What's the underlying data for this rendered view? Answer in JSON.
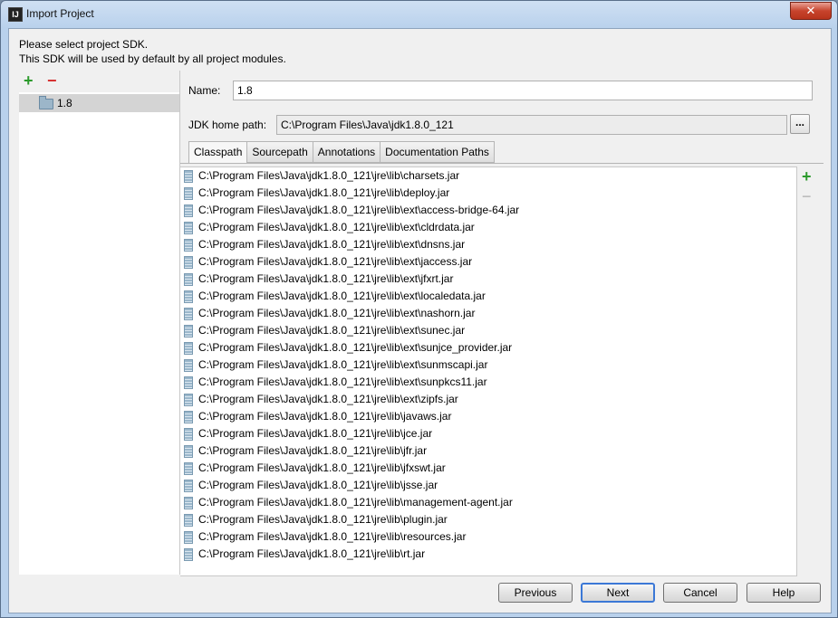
{
  "window": {
    "title": "Import Project",
    "app_icon": "IJ",
    "close_glyph": "✕"
  },
  "message": {
    "line1": "Please select project SDK.",
    "line2": "This SDK will be used by default by all project modules."
  },
  "sdk_list": {
    "add_glyph": "+",
    "remove_glyph": "−",
    "items": [
      "1.8"
    ]
  },
  "form": {
    "name_label": "Name:",
    "name_value": "1.8",
    "jdk_label": "JDK home path:",
    "jdk_value": "C:\\Program Files\\Java\\jdk1.8.0_121",
    "browse_label": "..."
  },
  "tabs": [
    "Classpath",
    "Sourcepath",
    "Annotations",
    "Documentation Paths"
  ],
  "active_tab": "Classpath",
  "classpath": [
    "C:\\Program Files\\Java\\jdk1.8.0_121\\jre\\lib\\charsets.jar",
    "C:\\Program Files\\Java\\jdk1.8.0_121\\jre\\lib\\deploy.jar",
    "C:\\Program Files\\Java\\jdk1.8.0_121\\jre\\lib\\ext\\access-bridge-64.jar",
    "C:\\Program Files\\Java\\jdk1.8.0_121\\jre\\lib\\ext\\cldrdata.jar",
    "C:\\Program Files\\Java\\jdk1.8.0_121\\jre\\lib\\ext\\dnsns.jar",
    "C:\\Program Files\\Java\\jdk1.8.0_121\\jre\\lib\\ext\\jaccess.jar",
    "C:\\Program Files\\Java\\jdk1.8.0_121\\jre\\lib\\ext\\jfxrt.jar",
    "C:\\Program Files\\Java\\jdk1.8.0_121\\jre\\lib\\ext\\localedata.jar",
    "C:\\Program Files\\Java\\jdk1.8.0_121\\jre\\lib\\ext\\nashorn.jar",
    "C:\\Program Files\\Java\\jdk1.8.0_121\\jre\\lib\\ext\\sunec.jar",
    "C:\\Program Files\\Java\\jdk1.8.0_121\\jre\\lib\\ext\\sunjce_provider.jar",
    "C:\\Program Files\\Java\\jdk1.8.0_121\\jre\\lib\\ext\\sunmscapi.jar",
    "C:\\Program Files\\Java\\jdk1.8.0_121\\jre\\lib\\ext\\sunpkcs11.jar",
    "C:\\Program Files\\Java\\jdk1.8.0_121\\jre\\lib\\ext\\zipfs.jar",
    "C:\\Program Files\\Java\\jdk1.8.0_121\\jre\\lib\\javaws.jar",
    "C:\\Program Files\\Java\\jdk1.8.0_121\\jre\\lib\\jce.jar",
    "C:\\Program Files\\Java\\jdk1.8.0_121\\jre\\lib\\jfr.jar",
    "C:\\Program Files\\Java\\jdk1.8.0_121\\jre\\lib\\jfxswt.jar",
    "C:\\Program Files\\Java\\jdk1.8.0_121\\jre\\lib\\jsse.jar",
    "C:\\Program Files\\Java\\jdk1.8.0_121\\jre\\lib\\management-agent.jar",
    "C:\\Program Files\\Java\\jdk1.8.0_121\\jre\\lib\\plugin.jar",
    "C:\\Program Files\\Java\\jdk1.8.0_121\\jre\\lib\\resources.jar",
    "C:\\Program Files\\Java\\jdk1.8.0_121\\jre\\lib\\rt.jar"
  ],
  "side_toolbar": {
    "add_glyph": "+",
    "remove_glyph": "−"
  },
  "buttons": {
    "previous": "Previous",
    "next": "Next",
    "cancel": "Cancel",
    "help": "Help"
  },
  "colors": {
    "add_green": "#2c9a2c",
    "remove_red": "#d63030",
    "default_button_border": "#3b78d6"
  },
  "icons": [
    "app-icon",
    "close-icon",
    "add-icon",
    "remove-icon",
    "folder-icon",
    "jar-icon"
  ]
}
